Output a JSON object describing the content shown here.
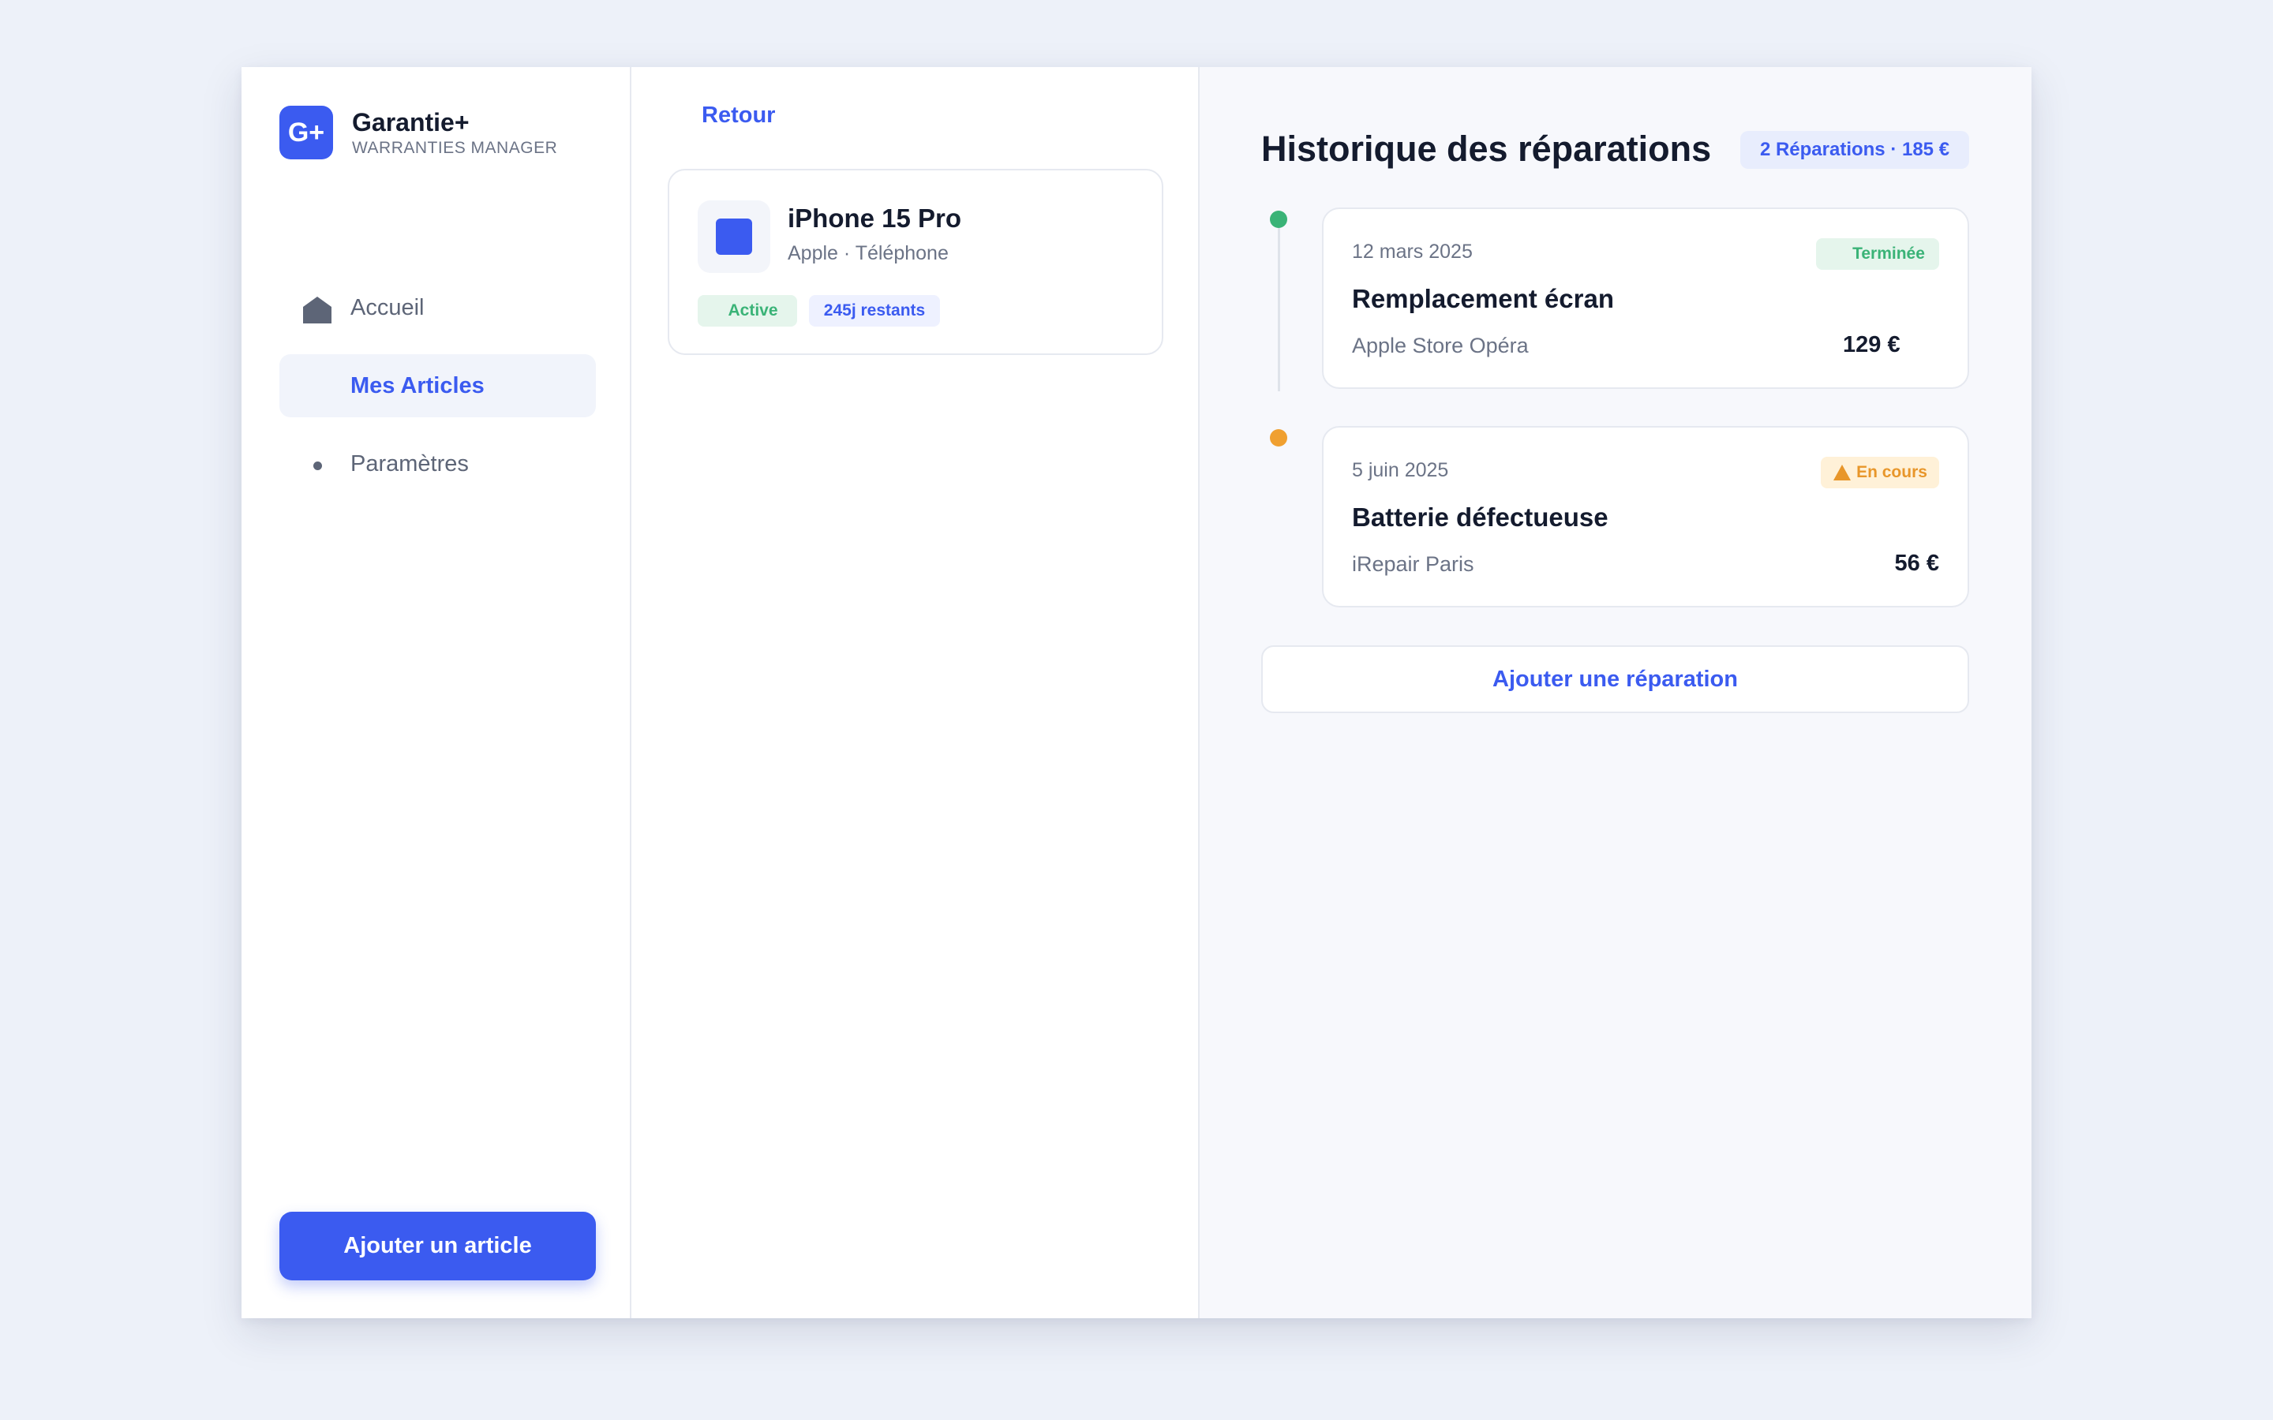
{
  "brand": {
    "logo_text": "G+",
    "name": "Garantie+",
    "subtitle": "WARRANTIES MANAGER"
  },
  "sidebar": {
    "items": [
      {
        "label": "Accueil",
        "icon": "house-icon"
      },
      {
        "label": "Mes Articles",
        "icon": "none",
        "active": true
      },
      {
        "label": "Paramètres",
        "icon": "dot-icon"
      }
    ],
    "add_button": "Ajouter un article"
  },
  "detail": {
    "back_label": "Retour",
    "item": {
      "title": "iPhone 15 Pro",
      "subtitle": "Apple · Téléphone",
      "status_badge": "Active",
      "days_badge": "245j restants"
    }
  },
  "history": {
    "title": "Historique des réparations",
    "summary": "2 Réparations · 185 €",
    "repairs": [
      {
        "date": "12 mars 2025",
        "status": "Terminée",
        "title": "Remplacement écran",
        "shop": "Apple Store Opéra",
        "price": "129 €",
        "dot_color": "#3ab377"
      },
      {
        "date": "5 juin 2025",
        "status": "En cours",
        "title": "Batterie défectueuse",
        "shop": "iRepair Paris",
        "price": "56 €",
        "dot_color": "#f0a030"
      }
    ],
    "add_button": "Ajouter une réparation"
  },
  "colors": {
    "accent": "#3b5bf0",
    "success": "#3ab377",
    "warning": "#f0a030",
    "background": "#edf1f9"
  }
}
